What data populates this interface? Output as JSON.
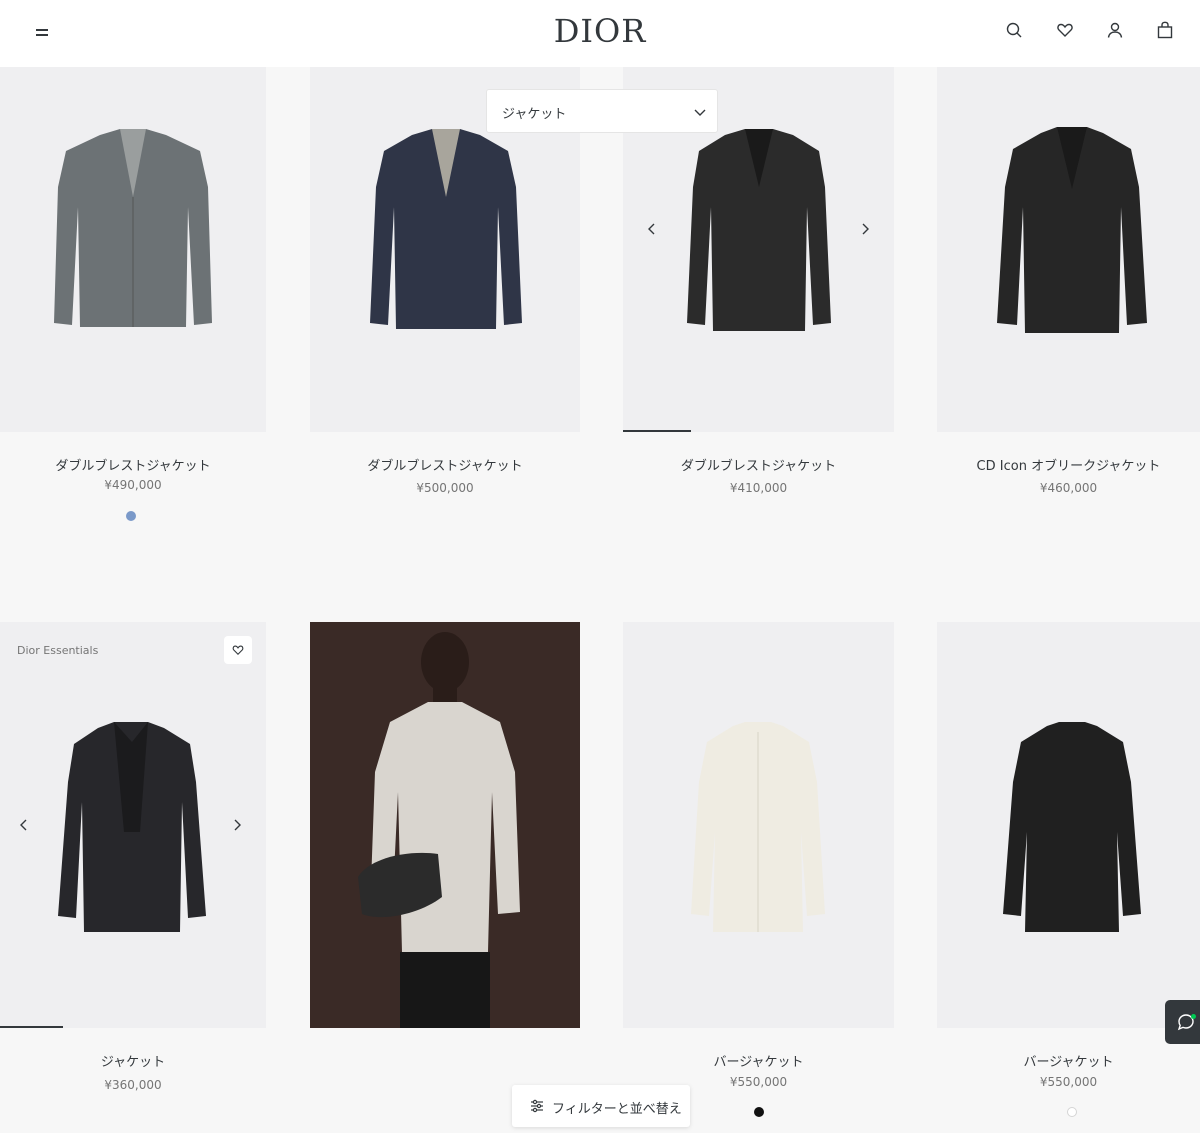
{
  "header": {
    "logo": "DIOR",
    "icons": [
      "menu-icon",
      "search-icon",
      "heart-icon",
      "user-icon",
      "bag-icon"
    ]
  },
  "category_select": {
    "value": "ジャケット"
  },
  "products": [
    {
      "name": "ダブルブレストジャケット",
      "price": "¥490,000",
      "swatch": "#7a99c9",
      "jacket_color": "#6c7275"
    },
    {
      "name": "ダブルブレストジャケット",
      "price": "¥500,000",
      "jacket_color": "#2f3547"
    },
    {
      "name": "ダブルブレストジャケット",
      "price": "¥410,000",
      "jacket_color": "#2b2b2b"
    },
    {
      "name": "CD Icon オブリークジャケット",
      "price": "¥460,000",
      "jacket_color": "#262626"
    },
    {
      "name": "ジャケット",
      "price": "¥360,000",
      "badge": "Dior Essentials",
      "jacket_color": "#27272b"
    },
    {
      "name": "バージャケット",
      "price": "¥550,000",
      "swatch": "#111111",
      "jacket_color": "#efece2"
    },
    {
      "name": "バージャケット",
      "price": "¥550,000",
      "swatch": "#ffffff",
      "jacket_color": "#202020"
    }
  ],
  "editorial": {
    "background": "#3a2a26",
    "jacket_color": "#d9d5cf",
    "bag_color": "#2b2b2b"
  },
  "filter_button": {
    "label": "フィルターと並べ替え"
  },
  "colors": {
    "background": "#f7f7f7",
    "card": "#efeff1",
    "text": "#33383c",
    "chat": "#33383c"
  }
}
